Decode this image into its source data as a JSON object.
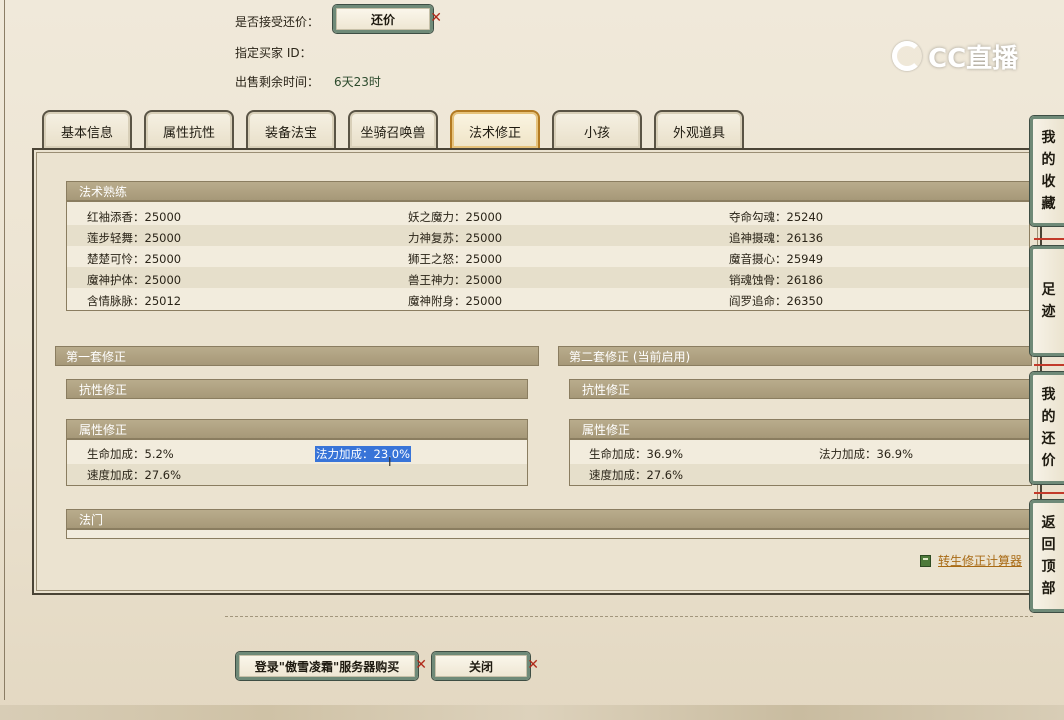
{
  "header": {
    "accept_counter_offer_label": "是否接受还价：",
    "counter_offer_button": "还价",
    "designated_buyer_label": "指定买家 ID：",
    "remaining_time_label": "出售剩余时间：",
    "remaining_time_value": "6天23时"
  },
  "logo": {
    "text": "CC直播"
  },
  "tabs": [
    {
      "label": "基本信息"
    },
    {
      "label": "属性抗性"
    },
    {
      "label": "装备法宝"
    },
    {
      "label": "坐骑召唤兽"
    },
    {
      "label": "法术修正",
      "active": true
    },
    {
      "label": "小孩"
    },
    {
      "label": "外观道具"
    }
  ],
  "spell_mastery": {
    "title": "法术熟练",
    "rows": [
      [
        "红袖添香：25000",
        "妖之魔力：25000",
        "夺命勾魂：25240"
      ],
      [
        "莲步轻舞：25000",
        "力神复苏：25000",
        "追神摄魂：26136"
      ],
      [
        "楚楚可怜：25000",
        "狮王之怒：25000",
        "魔音摄心：25949"
      ],
      [
        "魔神护体：25000",
        "兽王神力：25000",
        "销魂蚀骨：26186"
      ],
      [
        "含情脉脉：25012",
        "魔神附身：25000",
        "阎罗追命：26350"
      ]
    ]
  },
  "set1": {
    "title": "第一套修正",
    "resist_title": "抗性修正",
    "attr_title": "属性修正",
    "hp_bonus": "生命加成：5.2%",
    "mana_bonus": "法力加成：23.0%",
    "speed_bonus": "速度加成：27.6%"
  },
  "set2": {
    "title": "第二套修正 (当前启用)",
    "resist_title": "抗性修正",
    "attr_title": "属性修正",
    "hp_bonus": "生命加成：36.9%",
    "mana_bonus": "法力加成：36.9%",
    "speed_bonus": "速度加成：27.6%"
  },
  "faction": {
    "title": "法门"
  },
  "calc_link": "转生修正计算器",
  "footer": {
    "login_buy_button": "登录\"傲雪凌霜\"服务器购买",
    "close_button": "关闭"
  },
  "side_tabs": [
    {
      "label": [
        "我",
        "的",
        "收",
        "藏"
      ]
    },
    {
      "label": [
        "足",
        "迹"
      ]
    },
    {
      "label": [
        "我",
        "的",
        "还",
        "价"
      ]
    },
    {
      "label": [
        "返",
        "回",
        "顶",
        "部"
      ]
    }
  ],
  "colors": {
    "page_bg": "#ece4d2",
    "section_header": "#a69878",
    "active_tab_border": "#b27a22",
    "button_frame": "#6f8a78",
    "selection": "#3874d8",
    "link": "#a86a14"
  }
}
